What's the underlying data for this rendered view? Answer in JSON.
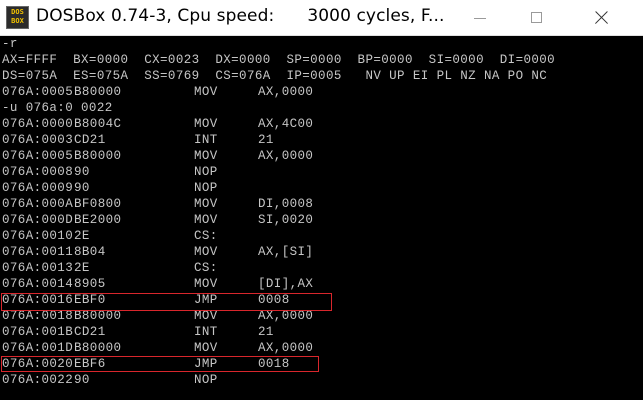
{
  "window": {
    "title": "DOSBox 0.74-3, Cpu speed:      3000 cycles, F...",
    "icon_text": [
      "DOS",
      "BOX"
    ]
  },
  "console": {
    "cmd_r": "-r",
    "regs1": "AX=FFFF  BX=0000  CX=0023  DX=0000  SP=0000  BP=0000  SI=0000  DI=0000",
    "regs2": "DS=075A  ES=075A  SS=0769  CS=076A  IP=0005   NV UP EI PL NZ NA PO NC",
    "cur": {
      "addr": "076A:0005",
      "bytes": "B80000",
      "mnemonic": "MOV",
      "operands": "AX,0000"
    },
    "cmd_u": "-u 076a:0 0022",
    "listing": [
      {
        "addr": "076A:0000",
        "bytes": "B8004C",
        "mnemonic": "MOV",
        "operands": "AX,4C00"
      },
      {
        "addr": "076A:0003",
        "bytes": "CD21",
        "mnemonic": "INT",
        "operands": "21"
      },
      {
        "addr": "076A:0005",
        "bytes": "B80000",
        "mnemonic": "MOV",
        "operands": "AX,0000"
      },
      {
        "addr": "076A:0008",
        "bytes": "90",
        "mnemonic": "NOP",
        "operands": ""
      },
      {
        "addr": "076A:0009",
        "bytes": "90",
        "mnemonic": "NOP",
        "operands": ""
      },
      {
        "addr": "076A:000A",
        "bytes": "BF0800",
        "mnemonic": "MOV",
        "operands": "DI,0008"
      },
      {
        "addr": "076A:000D",
        "bytes": "BE2000",
        "mnemonic": "MOV",
        "operands": "SI,0020"
      },
      {
        "addr": "076A:0010",
        "bytes": "2E",
        "mnemonic": "CS:",
        "operands": ""
      },
      {
        "addr": "076A:0011",
        "bytes": "8B04",
        "mnemonic": "MOV",
        "operands": "AX,[SI]"
      },
      {
        "addr": "076A:0013",
        "bytes": "2E",
        "mnemonic": "CS:",
        "operands": ""
      },
      {
        "addr": "076A:0014",
        "bytes": "8905",
        "mnemonic": "MOV",
        "operands": "[DI],AX"
      },
      {
        "addr": "076A:0016",
        "bytes": "EBF0",
        "mnemonic": "JMP",
        "operands": "0008"
      },
      {
        "addr": "076A:0018",
        "bytes": "B80000",
        "mnemonic": "MOV",
        "operands": "AX,0000"
      },
      {
        "addr": "076A:001B",
        "bytes": "CD21",
        "mnemonic": "INT",
        "operands": "21"
      },
      {
        "addr": "076A:001D",
        "bytes": "B80000",
        "mnemonic": "MOV",
        "operands": "AX,0000"
      },
      {
        "addr": "076A:0020",
        "bytes": "EBF6",
        "mnemonic": "JMP",
        "operands": "0018"
      },
      {
        "addr": "076A:0022",
        "bytes": "90",
        "mnemonic": "NOP",
        "operands": ""
      }
    ]
  },
  "colors": {
    "console_bg": "#000000",
    "console_text": "#c6c6c6",
    "highlight": "#d9262c",
    "titlebar_bg": "#ffffff"
  }
}
